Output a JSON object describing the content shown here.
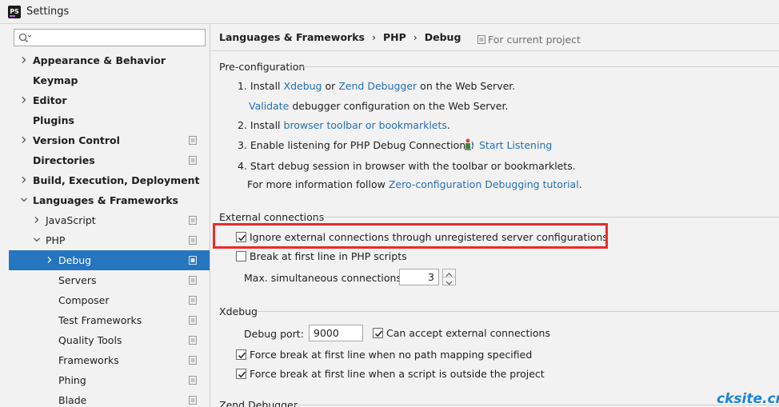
{
  "window": {
    "title": "Settings",
    "app_icon": "PS"
  },
  "search": {
    "placeholder": ""
  },
  "tree": [
    {
      "label": "Appearance & Behavior",
      "bold": true,
      "arrow": "right",
      "level": 0,
      "project": false
    },
    {
      "label": "Keymap",
      "bold": true,
      "arrow": "none",
      "level": 0,
      "project": false
    },
    {
      "label": "Editor",
      "bold": true,
      "arrow": "right",
      "level": 0,
      "project": false
    },
    {
      "label": "Plugins",
      "bold": true,
      "arrow": "none",
      "level": 0,
      "project": false
    },
    {
      "label": "Version Control",
      "bold": true,
      "arrow": "right",
      "level": 0,
      "project": true
    },
    {
      "label": "Directories",
      "bold": true,
      "arrow": "none",
      "level": 0,
      "project": true
    },
    {
      "label": "Build, Execution, Deployment",
      "bold": true,
      "arrow": "right",
      "level": 0,
      "project": false
    },
    {
      "label": "Languages & Frameworks",
      "bold": true,
      "arrow": "down",
      "level": 0,
      "project": false
    },
    {
      "label": "JavaScript",
      "bold": false,
      "arrow": "right",
      "level": 1,
      "project": true
    },
    {
      "label": "PHP",
      "bold": false,
      "arrow": "down",
      "level": 1,
      "project": true
    },
    {
      "label": "Debug",
      "bold": false,
      "arrow": "right",
      "level": 2,
      "project": true,
      "selected": true
    },
    {
      "label": "Servers",
      "bold": false,
      "arrow": "none",
      "level": 2,
      "project": true
    },
    {
      "label": "Composer",
      "bold": false,
      "arrow": "none",
      "level": 2,
      "project": true
    },
    {
      "label": "Test Frameworks",
      "bold": false,
      "arrow": "none",
      "level": 2,
      "project": true
    },
    {
      "label": "Quality Tools",
      "bold": false,
      "arrow": "none",
      "level": 2,
      "project": true
    },
    {
      "label": "Frameworks",
      "bold": false,
      "arrow": "none",
      "level": 2,
      "project": true
    },
    {
      "label": "Phing",
      "bold": false,
      "arrow": "none",
      "level": 2,
      "project": true
    },
    {
      "label": "Blade",
      "bold": false,
      "arrow": "none",
      "level": 2,
      "project": true
    }
  ],
  "breadcrumb": {
    "part1": "Languages & Frameworks",
    "sep1": "›",
    "part2": "PHP",
    "sep2": "›",
    "part3": "Debug"
  },
  "scope_label": "For current project",
  "preconfig": {
    "title": "Pre-configuration",
    "step1_a": "1. Install ",
    "step1_link1": "Xdebug",
    "step1_b": " or ",
    "step1_link2": "Zend Debugger",
    "step1_c": " on the Web Server.",
    "step1b_link": "Validate",
    "step1b_text": " debugger configuration on the Web Server.",
    "step2_a": "2. Install ",
    "step2_link": "browser toolbar or bookmarklets",
    "step2_b": ".",
    "step3_a": "3. Enable listening for PHP Debug Connections: ",
    "step3_link": "Start Listening",
    "step4": "4. Start debug session in browser with the toolbar or bookmarklets.",
    "step4b_a": "For more information follow ",
    "step4b_link": "Zero-configuration Debugging tutorial",
    "step4b_b": "."
  },
  "external": {
    "title": "External connections",
    "ignore_label": "Ignore external connections through unregistered server configurations",
    "ignore_checked": true,
    "break_label": "Break at first line in PHP scripts",
    "break_checked": false,
    "max_label": "Max. simultaneous connections:",
    "max_value": "3"
  },
  "xdebug": {
    "title": "Xdebug",
    "port_label": "Debug port:",
    "port_value": "9000",
    "accept_label": "Can accept external connections",
    "accept_checked": true,
    "force_nopath_label": "Force break at first line when no path mapping specified",
    "force_nopath_checked": true,
    "force_outside_label": "Force break at first line when a script is outside the project",
    "force_outside_checked": true
  },
  "zend": {
    "title": "Zend Debugger"
  },
  "watermark": "cksite.cn",
  "colors": {
    "selection": "#2675bf",
    "link": "#2470b3",
    "highlight": "#ec2a2a",
    "watermark": "#1a84d8"
  }
}
